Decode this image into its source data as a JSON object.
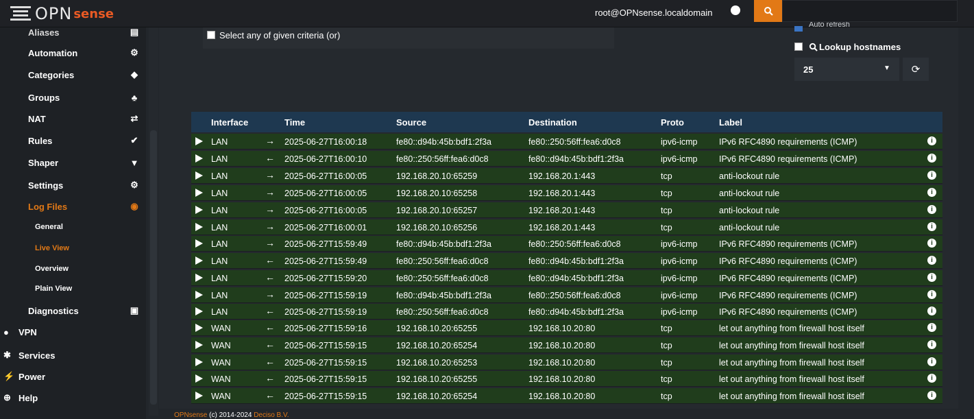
{
  "header": {
    "logo_text": "OPN",
    "logo_accent": "sense",
    "user": "root@OPNsense.localdomain",
    "search_placeholder": ""
  },
  "sidebar": {
    "items": [
      {
        "label": "Aliases",
        "icon": "list-icon",
        "glyph": "▤"
      },
      {
        "label": "Automation",
        "icon": "gear-icon",
        "glyph": "⚙"
      },
      {
        "label": "Categories",
        "icon": "tag-icon",
        "glyph": "◆"
      },
      {
        "label": "Groups",
        "icon": "sitemap-icon",
        "glyph": "♣"
      },
      {
        "label": "NAT",
        "icon": "exchange-icon",
        "glyph": "⇄"
      },
      {
        "label": "Rules",
        "icon": "check-icon",
        "glyph": "✔"
      },
      {
        "label": "Shaper",
        "icon": "filter-icon",
        "glyph": "▼"
      },
      {
        "label": "Settings",
        "icon": "cogs-icon",
        "glyph": "⚙"
      },
      {
        "label": "Log Files",
        "icon": "eye-icon",
        "glyph": "◉"
      }
    ],
    "log_subitems": [
      "General",
      "Live View",
      "Overview",
      "Plain View"
    ],
    "diagnostics": {
      "label": "Diagnostics",
      "glyph": "▣"
    },
    "top_items": [
      {
        "label": "VPN",
        "glyph": "●"
      },
      {
        "label": "Services",
        "glyph": "✱"
      },
      {
        "label": "Power",
        "glyph": "⚡"
      },
      {
        "label": "Help",
        "glyph": "⊕"
      }
    ]
  },
  "filters": {
    "criteria_label": "Select any of given criteria (or)",
    "auto_refresh_label": "Auto refresh",
    "lookup_label": "Lookup hostnames",
    "limit_value": "25"
  },
  "table": {
    "headers": [
      "Interface",
      "Time",
      "Source",
      "Destination",
      "Proto",
      "Label"
    ],
    "rows": [
      {
        "iface": "LAN",
        "dir": "→",
        "time": "2025-06-27T16:00:18",
        "src": "fe80::d94b:45b:bdf1:2f3a",
        "dst": "fe80::250:56ff:fea6:d0c8",
        "proto": "ipv6-icmp",
        "label": "IPv6 RFC4890 requirements (ICMP)"
      },
      {
        "iface": "LAN",
        "dir": "←",
        "time": "2025-06-27T16:00:10",
        "src": "fe80::250:56ff:fea6:d0c8",
        "dst": "fe80::d94b:45b:bdf1:2f3a",
        "proto": "ipv6-icmp",
        "label": "IPv6 RFC4890 requirements (ICMP)"
      },
      {
        "iface": "LAN",
        "dir": "→",
        "time": "2025-06-27T16:00:05",
        "src": "192.168.20.10:65259",
        "dst": "192.168.20.1:443",
        "proto": "tcp",
        "label": "anti-lockout rule"
      },
      {
        "iface": "LAN",
        "dir": "→",
        "time": "2025-06-27T16:00:05",
        "src": "192.168.20.10:65258",
        "dst": "192.168.20.1:443",
        "proto": "tcp",
        "label": "anti-lockout rule"
      },
      {
        "iface": "LAN",
        "dir": "→",
        "time": "2025-06-27T16:00:05",
        "src": "192.168.20.10:65257",
        "dst": "192.168.20.1:443",
        "proto": "tcp",
        "label": "anti-lockout rule"
      },
      {
        "iface": "LAN",
        "dir": "→",
        "time": "2025-06-27T16:00:01",
        "src": "192.168.20.10:65256",
        "dst": "192.168.20.1:443",
        "proto": "tcp",
        "label": "anti-lockout rule"
      },
      {
        "iface": "LAN",
        "dir": "→",
        "time": "2025-06-27T15:59:49",
        "src": "fe80::d94b:45b:bdf1:2f3a",
        "dst": "fe80::250:56ff:fea6:d0c8",
        "proto": "ipv6-icmp",
        "label": "IPv6 RFC4890 requirements (ICMP)"
      },
      {
        "iface": "LAN",
        "dir": "←",
        "time": "2025-06-27T15:59:49",
        "src": "fe80::250:56ff:fea6:d0c8",
        "dst": "fe80::d94b:45b:bdf1:2f3a",
        "proto": "ipv6-icmp",
        "label": "IPv6 RFC4890 requirements (ICMP)"
      },
      {
        "iface": "LAN",
        "dir": "←",
        "time": "2025-06-27T15:59:20",
        "src": "fe80::250:56ff:fea6:d0c8",
        "dst": "fe80::d94b:45b:bdf1:2f3a",
        "proto": "ipv6-icmp",
        "label": "IPv6 RFC4890 requirements (ICMP)"
      },
      {
        "iface": "LAN",
        "dir": "→",
        "time": "2025-06-27T15:59:19",
        "src": "fe80::d94b:45b:bdf1:2f3a",
        "dst": "fe80::250:56ff:fea6:d0c8",
        "proto": "ipv6-icmp",
        "label": "IPv6 RFC4890 requirements (ICMP)"
      },
      {
        "iface": "LAN",
        "dir": "←",
        "time": "2025-06-27T15:59:19",
        "src": "fe80::250:56ff:fea6:d0c8",
        "dst": "fe80::d94b:45b:bdf1:2f3a",
        "proto": "ipv6-icmp",
        "label": "IPv6 RFC4890 requirements (ICMP)"
      },
      {
        "iface": "WAN",
        "dir": "←",
        "time": "2025-06-27T15:59:16",
        "src": "192.168.10.20:65255",
        "dst": "192.168.10.20:80",
        "proto": "tcp",
        "label": "let out anything from firewall host itself"
      },
      {
        "iface": "WAN",
        "dir": "←",
        "time": "2025-06-27T15:59:15",
        "src": "192.168.10.20:65254",
        "dst": "192.168.10.20:80",
        "proto": "tcp",
        "label": "let out anything from firewall host itself"
      },
      {
        "iface": "WAN",
        "dir": "←",
        "time": "2025-06-27T15:59:15",
        "src": "192.168.10.20:65253",
        "dst": "192.168.10.20:80",
        "proto": "tcp",
        "label": "let out anything from firewall host itself"
      },
      {
        "iface": "WAN",
        "dir": "←",
        "time": "2025-06-27T15:59:15",
        "src": "192.168.10.20:65255",
        "dst": "192.168.10.20:80",
        "proto": "tcp",
        "label": "let out anything from firewall host itself"
      },
      {
        "iface": "WAN",
        "dir": "←",
        "time": "2025-06-27T15:59:15",
        "src": "192.168.10.20:65254",
        "dst": "192.168.10.20:80",
        "proto": "tcp",
        "label": "let out anything from firewall host itself"
      }
    ]
  },
  "footer": {
    "brand": "OPNsense",
    "copy": "(c) 2014-2024",
    "company": "Deciso B.V."
  },
  "colors": {
    "accent": "#e27916",
    "row_pass": "#203d1c",
    "header": "#1e3850"
  }
}
